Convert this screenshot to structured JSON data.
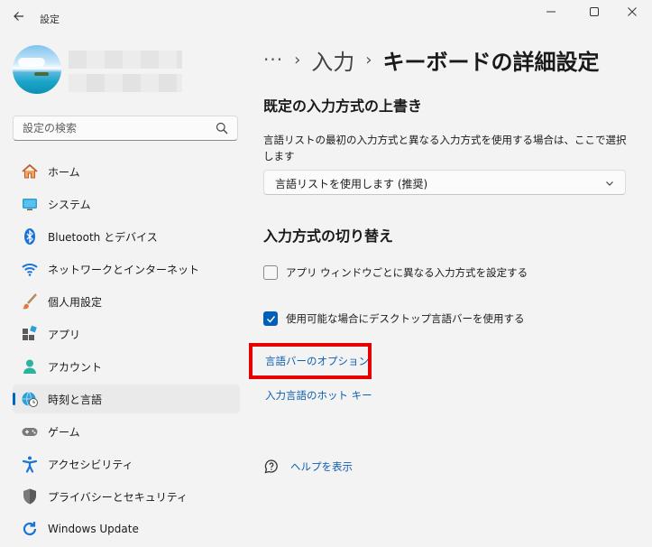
{
  "window": {
    "title": "設定",
    "back_icon": "arrow-left-icon",
    "minimize_icon": "minimize-icon",
    "maximize_icon": "maximize-icon",
    "close_icon": "close-icon"
  },
  "search": {
    "placeholder": "設定の検索",
    "icon": "search-icon"
  },
  "sidebar": {
    "items": [
      {
        "label": "ホーム",
        "icon": "home-icon"
      },
      {
        "label": "システム",
        "icon": "monitor-icon"
      },
      {
        "label": "Bluetooth とデバイス",
        "icon": "bluetooth-icon"
      },
      {
        "label": "ネットワークとインターネット",
        "icon": "wifi-icon"
      },
      {
        "label": "個人用設定",
        "icon": "brush-icon"
      },
      {
        "label": "アプリ",
        "icon": "apps-icon"
      },
      {
        "label": "アカウント",
        "icon": "person-icon"
      },
      {
        "label": "時刻と言語",
        "icon": "globe-clock-icon",
        "active": true
      },
      {
        "label": "ゲーム",
        "icon": "gamepad-icon"
      },
      {
        "label": "アクセシビリティ",
        "icon": "accessibility-icon"
      },
      {
        "label": "プライバシーとセキュリティ",
        "icon": "shield-icon"
      },
      {
        "label": "Windows Update",
        "icon": "update-icon"
      }
    ]
  },
  "breadcrumb": {
    "more": "···",
    "sep1": "›",
    "link": "入力",
    "sep2": "›",
    "current": "キーボードの詳細設定"
  },
  "override": {
    "heading": "既定の入力方式の上書き",
    "description": "言語リストの最初の入力方式と異なる入力方式を使用する場合は、ここで選択します",
    "dropdown_value": "言語リストを使用します (推奨)"
  },
  "switching": {
    "heading": "入力方式の切り替え",
    "checkbox1_label": "アプリ ウィンドウごとに異なる入力方式を設定する",
    "checkbox1_checked": false,
    "checkbox2_label": "使用可能な場合にデスクトップ言語バーを使用する",
    "checkbox2_checked": true,
    "link_language_bar": "言語バーのオプション",
    "link_hotkeys": "入力言語のホット キー"
  },
  "help": {
    "label": "ヘルプを表示",
    "icon": "help-chat-icon"
  },
  "colors": {
    "accent": "#005fb8",
    "link": "#0e5fb0",
    "highlight": "#e60000",
    "background": "#f3f3f3"
  }
}
